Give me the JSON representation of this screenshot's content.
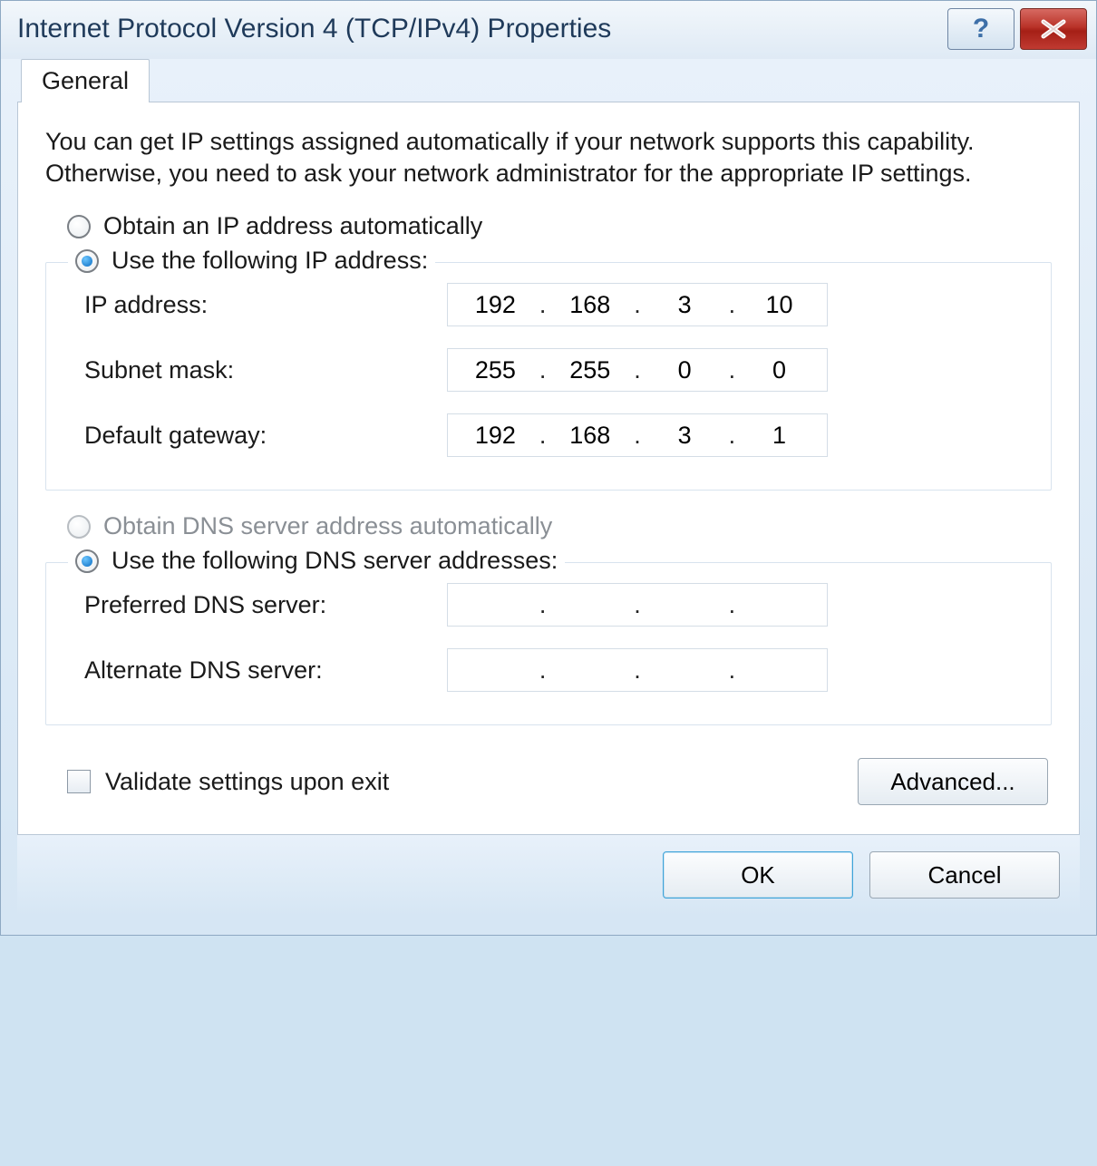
{
  "title": "Internet Protocol Version 4 (TCP/IPv4) Properties",
  "tabs": {
    "general": "General"
  },
  "intro": "You can get IP settings assigned automatically if your network supports this capability. Otherwise, you need to ask your network administrator for the appropriate IP settings.",
  "ip_section": {
    "radio_auto": "Obtain an IP address automatically",
    "radio_manual": "Use the following IP address:",
    "selected": "manual",
    "fields": {
      "ip_label": "IP address:",
      "ip": [
        "192",
        "168",
        "3",
        "10"
      ],
      "mask_label": "Subnet mask:",
      "mask": [
        "255",
        "255",
        "0",
        "0"
      ],
      "gw_label": "Default gateway:",
      "gw": [
        "192",
        "168",
        "3",
        "1"
      ]
    }
  },
  "dns_section": {
    "radio_auto": "Obtain DNS server address automatically",
    "radio_auto_enabled": false,
    "radio_manual": "Use the following DNS server addresses:",
    "selected": "manual",
    "fields": {
      "pref_label": "Preferred DNS server:",
      "pref": [
        "",
        "",
        "",
        ""
      ],
      "alt_label": "Alternate DNS server:",
      "alt": [
        "",
        "",
        "",
        ""
      ]
    }
  },
  "validate": {
    "label": "Validate settings upon exit",
    "checked": false
  },
  "buttons": {
    "advanced": "Advanced...",
    "ok": "OK",
    "cancel": "Cancel"
  }
}
